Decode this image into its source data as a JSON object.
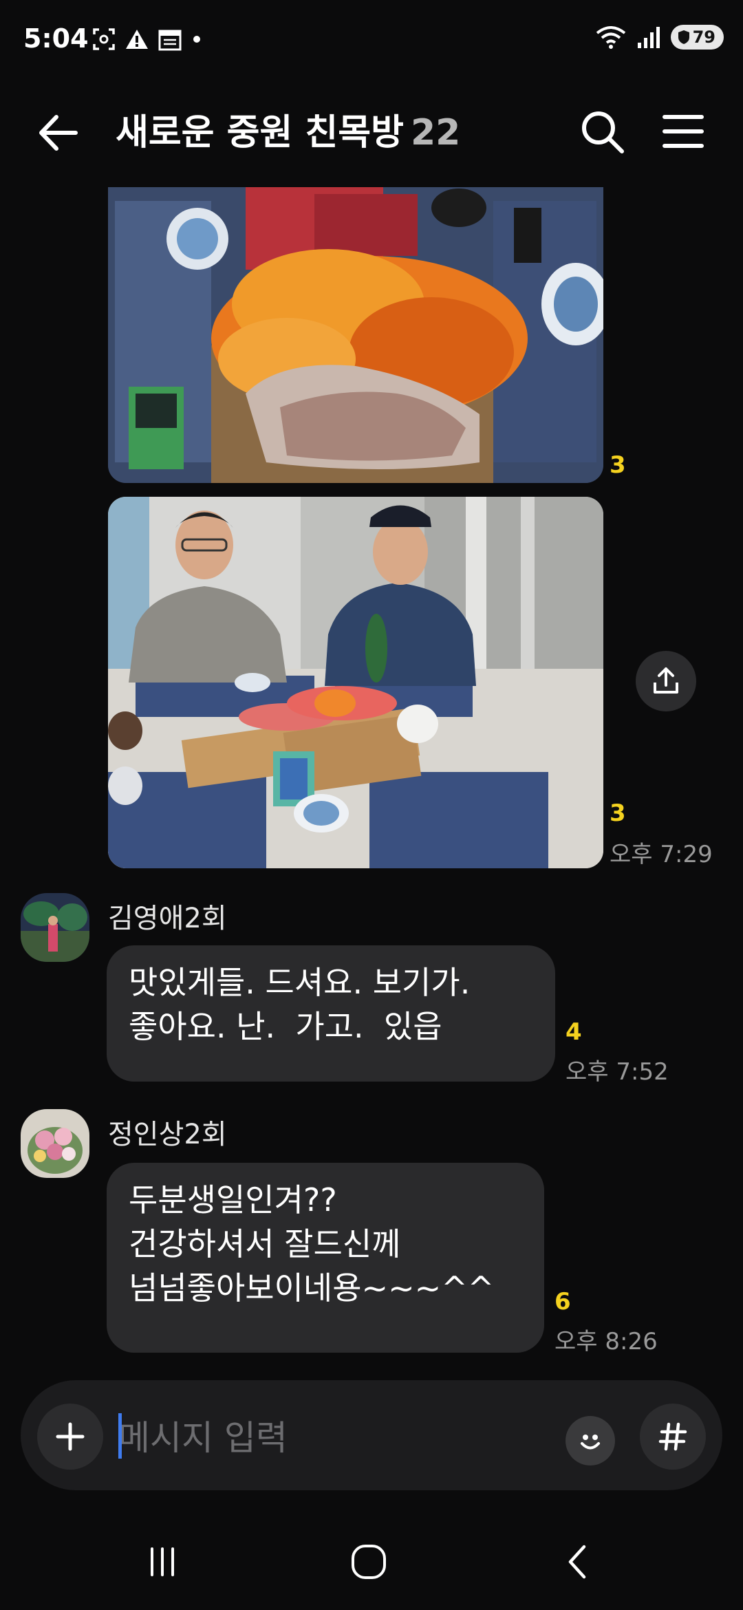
{
  "status_bar": {
    "time": "5:04",
    "battery": "79",
    "icons": [
      "screenshot-icon",
      "warning-icon",
      "calendar-icon",
      "dot-icon",
      "wifi-icon",
      "signal-icon",
      "battery-icon"
    ]
  },
  "header": {
    "title": "새로운 중원 친목방",
    "member_count": "22"
  },
  "messages": [
    {
      "type": "photo",
      "description_icon": "photo-sashimi-platter",
      "unread": "3"
    },
    {
      "type": "photo",
      "description_icon": "photo-two-men-dinner",
      "unread": "3",
      "time": "오후 7:29"
    },
    {
      "type": "text",
      "sender": "김영애2회",
      "lines": [
        "맛있게들. 드셔요. 보기가.",
        "좋아요. 난.  가고.  있읍"
      ],
      "unread": "4",
      "time": "오후 7:52"
    },
    {
      "type": "text",
      "sender": "정인상2회",
      "lines": [
        "두분생일인겨??",
        "건강하셔서 잘드신께",
        "넘넘좋아보이네용~~~^^"
      ],
      "unread": "6",
      "time": "오후 8:26"
    }
  ],
  "input": {
    "placeholder": "메시지 입력",
    "value": ""
  },
  "colors": {
    "background": "#0b0b0c",
    "bubble": "#2a2a2c",
    "unread": "#f5d21f",
    "cursor": "#3f7cf0"
  }
}
